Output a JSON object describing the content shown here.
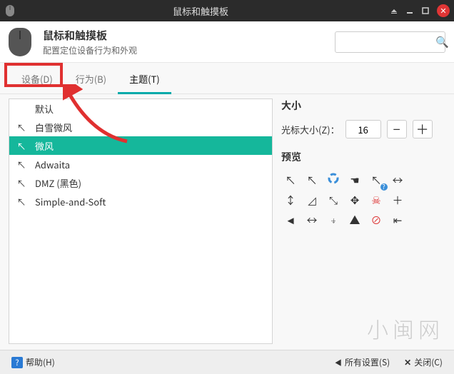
{
  "window": {
    "title": "鼠标和触摸板"
  },
  "header": {
    "title": "鼠标和触摸板",
    "subtitle": "配置定位设备行为和外观"
  },
  "tabs": {
    "devices": "设备(D)",
    "behavior": "行为(B)",
    "theme": "主题(T)"
  },
  "themes": {
    "items": [
      {
        "label": "默认",
        "glyph": "",
        "selected": false
      },
      {
        "label": "白雪微风",
        "glyph": "↖",
        "selected": false
      },
      {
        "label": "微风",
        "glyph": "↖",
        "selected": true
      },
      {
        "label": "Adwaita",
        "glyph": "↖",
        "selected": false
      },
      {
        "label": "DMZ (黑色)",
        "glyph": "↖",
        "selected": false
      },
      {
        "label": "Simple-and-Soft",
        "glyph": "↖",
        "selected": false
      }
    ]
  },
  "size": {
    "section_label": "大小",
    "label": "光标大小(Z)：",
    "value": "16"
  },
  "preview": {
    "section_label": "预览",
    "cells": [
      "cursor-default",
      "cursor-context",
      "progress-ring",
      "cursor-link",
      "cursor-help",
      "resize-ew",
      "resize-ns",
      "corner-mark",
      "resize-nwse",
      "move",
      "skull",
      "crosshair",
      "cursor-solid",
      "resize-ew2",
      "up-down-bar",
      "cursor-up",
      "no-entry",
      "insert-left"
    ]
  },
  "footer": {
    "help": "帮助(H)",
    "all": "所有设置(S)",
    "close": "关闭(C)"
  },
  "icons": {
    "cursor-default": "↖",
    "cursor-context": "↖",
    "cursor-link": "☚",
    "cursor-help": "?",
    "resize-ew": "↔",
    "resize-ns": "↕",
    "corner-mark": "◿",
    "resize-nwse": "⤡",
    "move": "✥",
    "skull": "☠",
    "crosshair": "＋",
    "cursor-solid": "◄",
    "resize-ew2": "↔",
    "up-down-bar": "⍖",
    "cursor-up": "▲",
    "no-entry": "⊘",
    "insert-left": "⇤"
  }
}
